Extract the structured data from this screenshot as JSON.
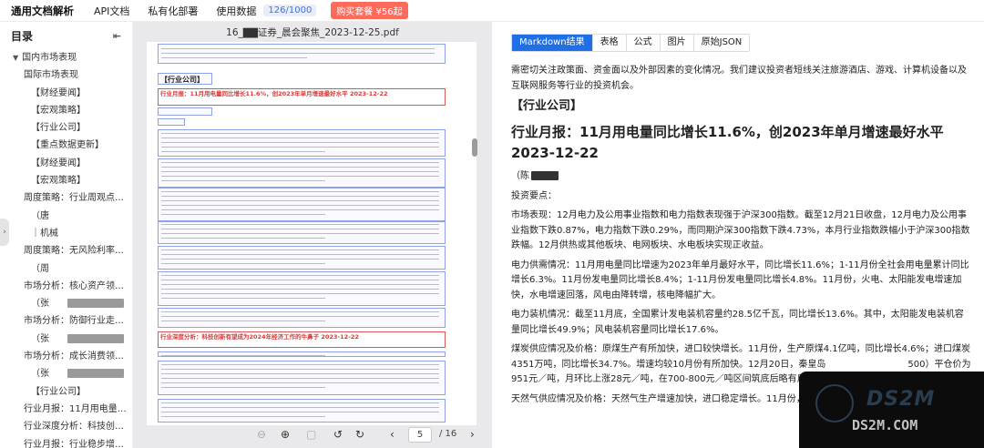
{
  "topbar": {
    "brand": "通用文档解析",
    "nav": [
      "API文档",
      "私有化部署",
      "使用数据"
    ],
    "quota": "126/1000",
    "buy_label": "购买套餐 ¥56起"
  },
  "toc": {
    "title": "目录",
    "items": [
      {
        "label": "国内市场表现",
        "level": 0,
        "expanded": true
      },
      {
        "label": "国际市场表现",
        "level": 1
      },
      {
        "label": "【财经要闻】",
        "level": 2
      },
      {
        "label": "【宏观策略】",
        "level": 2
      },
      {
        "label": "【行业公司】",
        "level": 2
      },
      {
        "label": "【重点数据更新】",
        "level": 2
      },
      {
        "label": "【财经要闻】",
        "level": 2
      },
      {
        "label": "【宏观策略】",
        "level": 2
      },
      {
        "label": "周度策略：行业周观点20...",
        "level": 1
      },
      {
        "label": "（唐",
        "level": 2
      },
      {
        "label": "｜机械",
        "level": 2
      },
      {
        "label": "周度策略：无风险利率下...",
        "level": 1
      },
      {
        "label": "（周",
        "level": 2
      },
      {
        "label": "市场分析：核心资产领涨A...",
        "level": 1
      },
      {
        "label": "（张",
        "level": 2
      },
      {
        "label": "市场分析：防御行业走强A...",
        "level": 1
      },
      {
        "label": "（张",
        "level": 2
      },
      {
        "label": "市场分析：成长消费领涨A...",
        "level": 1
      },
      {
        "label": "（张",
        "level": 2
      },
      {
        "label": "【行业公司】",
        "level": 2
      },
      {
        "label": "行业月报：11月用电量同...",
        "level": 1
      },
      {
        "label": "行业深度分析：科技创新...",
        "level": 1
      },
      {
        "label": "行业月报：行业稳步增长...",
        "level": 1
      }
    ]
  },
  "pdf": {
    "title": "16_▇▇证券_晨会聚焦_2023-12-25.pdf",
    "page_heading": "【行业公司】",
    "red_heading": "行业月报：11月用电量同比增长11.6%，创2023年单月增速最好水平 2023-12-22",
    "red_heading2": "行业深度分析：科技创新有望成为2024年经济工作的牛鼻子 2023-12-22",
    "current_page": "5",
    "total_pages": "/ 16"
  },
  "result": {
    "tabs": [
      "Markdown结果",
      "表格",
      "公式",
      "图片",
      "原始JSON"
    ],
    "active_tab": 0,
    "intro": "需密切关注政策面、资金面以及外部因素的变化情况。我们建议投资者短线关注旅游酒店、游戏、计算机设备以及互联网服务等行业的投资机会。",
    "h3": "【行业公司】",
    "h2": "行业月报：11月用电量同比增长11.6%，创2023年单月增速最好水平 2023-12-22",
    "author": "（陈",
    "summary_label": "投资要点：",
    "paragraphs": [
      "市场表现：12月电力及公用事业指数和电力指数表现强于沪深300指数。截至12月21日收盘，12月电力及公用事业指数下跌0.87%，电力指数下跌0.29%，而同期沪深300指数下跌4.73%，本月行业指数跌幅小于沪深300指数跌幅。12月供热或其他板块、电网板块、水电板块实现正收益。",
      "电力供需情况：11月用电量同比增速为2023年单月最好水平，同比增长11.6%；1-11月份全社会用电量累计同比增长6.3%。11月份发电量同比增长8.4%；1-11月份发电量同比增长4.8%。11月份，火电、太阳能发电增速加快，水电增速回落，风电由降转增，核电降幅扩大。",
      "电力装机情况：截至11月底，全国累计发电装机容量约28.5亿千瓦，同比增长13.6%。其中，太阳能发电装机容量同比增长49.9%；风电装机容量同比增长17.6%。",
      "煤炭供应情况及价格：原煤生产有所加快，进口较快增长。11月份，生产原煤4.1亿吨，同比增长4.6%；进口煤炭4351万吨，同比增长34.7%。增速均较10月份有所加快。12月20日，秦皇岛　　　　　　　　　500）平仓价为951元／吨，月环比上涨28元／吨，在700-800元／吨区间筑底后略有反弹。",
      "天然气供应情况及价格：天然气生产增速加快，进口稳定增长。11月份，生产天"
    ]
  },
  "watermark": {
    "line1": "DS2M",
    "line2": "DS2M.COM"
  }
}
